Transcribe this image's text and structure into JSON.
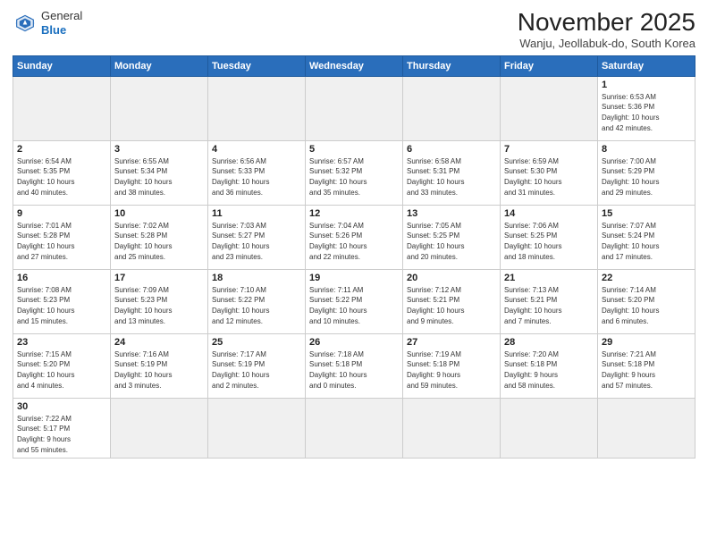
{
  "logo": {
    "general": "General",
    "blue": "Blue"
  },
  "title": "November 2025",
  "subtitle": "Wanju, Jeollabuk-do, South Korea",
  "headers": [
    "Sunday",
    "Monday",
    "Tuesday",
    "Wednesday",
    "Thursday",
    "Friday",
    "Saturday"
  ],
  "weeks": [
    [
      {
        "day": "",
        "info": ""
      },
      {
        "day": "",
        "info": ""
      },
      {
        "day": "",
        "info": ""
      },
      {
        "day": "",
        "info": ""
      },
      {
        "day": "",
        "info": ""
      },
      {
        "day": "",
        "info": ""
      },
      {
        "day": "1",
        "info": "Sunrise: 6:53 AM\nSunset: 5:36 PM\nDaylight: 10 hours\nand 42 minutes."
      }
    ],
    [
      {
        "day": "2",
        "info": "Sunrise: 6:54 AM\nSunset: 5:35 PM\nDaylight: 10 hours\nand 40 minutes."
      },
      {
        "day": "3",
        "info": "Sunrise: 6:55 AM\nSunset: 5:34 PM\nDaylight: 10 hours\nand 38 minutes."
      },
      {
        "day": "4",
        "info": "Sunrise: 6:56 AM\nSunset: 5:33 PM\nDaylight: 10 hours\nand 36 minutes."
      },
      {
        "day": "5",
        "info": "Sunrise: 6:57 AM\nSunset: 5:32 PM\nDaylight: 10 hours\nand 35 minutes."
      },
      {
        "day": "6",
        "info": "Sunrise: 6:58 AM\nSunset: 5:31 PM\nDaylight: 10 hours\nand 33 minutes."
      },
      {
        "day": "7",
        "info": "Sunrise: 6:59 AM\nSunset: 5:30 PM\nDaylight: 10 hours\nand 31 minutes."
      },
      {
        "day": "8",
        "info": "Sunrise: 7:00 AM\nSunset: 5:29 PM\nDaylight: 10 hours\nand 29 minutes."
      }
    ],
    [
      {
        "day": "9",
        "info": "Sunrise: 7:01 AM\nSunset: 5:28 PM\nDaylight: 10 hours\nand 27 minutes."
      },
      {
        "day": "10",
        "info": "Sunrise: 7:02 AM\nSunset: 5:28 PM\nDaylight: 10 hours\nand 25 minutes."
      },
      {
        "day": "11",
        "info": "Sunrise: 7:03 AM\nSunset: 5:27 PM\nDaylight: 10 hours\nand 23 minutes."
      },
      {
        "day": "12",
        "info": "Sunrise: 7:04 AM\nSunset: 5:26 PM\nDaylight: 10 hours\nand 22 minutes."
      },
      {
        "day": "13",
        "info": "Sunrise: 7:05 AM\nSunset: 5:25 PM\nDaylight: 10 hours\nand 20 minutes."
      },
      {
        "day": "14",
        "info": "Sunrise: 7:06 AM\nSunset: 5:25 PM\nDaylight: 10 hours\nand 18 minutes."
      },
      {
        "day": "15",
        "info": "Sunrise: 7:07 AM\nSunset: 5:24 PM\nDaylight: 10 hours\nand 17 minutes."
      }
    ],
    [
      {
        "day": "16",
        "info": "Sunrise: 7:08 AM\nSunset: 5:23 PM\nDaylight: 10 hours\nand 15 minutes."
      },
      {
        "day": "17",
        "info": "Sunrise: 7:09 AM\nSunset: 5:23 PM\nDaylight: 10 hours\nand 13 minutes."
      },
      {
        "day": "18",
        "info": "Sunrise: 7:10 AM\nSunset: 5:22 PM\nDaylight: 10 hours\nand 12 minutes."
      },
      {
        "day": "19",
        "info": "Sunrise: 7:11 AM\nSunset: 5:22 PM\nDaylight: 10 hours\nand 10 minutes."
      },
      {
        "day": "20",
        "info": "Sunrise: 7:12 AM\nSunset: 5:21 PM\nDaylight: 10 hours\nand 9 minutes."
      },
      {
        "day": "21",
        "info": "Sunrise: 7:13 AM\nSunset: 5:21 PM\nDaylight: 10 hours\nand 7 minutes."
      },
      {
        "day": "22",
        "info": "Sunrise: 7:14 AM\nSunset: 5:20 PM\nDaylight: 10 hours\nand 6 minutes."
      }
    ],
    [
      {
        "day": "23",
        "info": "Sunrise: 7:15 AM\nSunset: 5:20 PM\nDaylight: 10 hours\nand 4 minutes."
      },
      {
        "day": "24",
        "info": "Sunrise: 7:16 AM\nSunset: 5:19 PM\nDaylight: 10 hours\nand 3 minutes."
      },
      {
        "day": "25",
        "info": "Sunrise: 7:17 AM\nSunset: 5:19 PM\nDaylight: 10 hours\nand 2 minutes."
      },
      {
        "day": "26",
        "info": "Sunrise: 7:18 AM\nSunset: 5:18 PM\nDaylight: 10 hours\nand 0 minutes."
      },
      {
        "day": "27",
        "info": "Sunrise: 7:19 AM\nSunset: 5:18 PM\nDaylight: 9 hours\nand 59 minutes."
      },
      {
        "day": "28",
        "info": "Sunrise: 7:20 AM\nSunset: 5:18 PM\nDaylight: 9 hours\nand 58 minutes."
      },
      {
        "day": "29",
        "info": "Sunrise: 7:21 AM\nSunset: 5:18 PM\nDaylight: 9 hours\nand 57 minutes."
      }
    ],
    [
      {
        "day": "30",
        "info": "Sunrise: 7:22 AM\nSunset: 5:17 PM\nDaylight: 9 hours\nand 55 minutes."
      },
      {
        "day": "",
        "info": ""
      },
      {
        "day": "",
        "info": ""
      },
      {
        "day": "",
        "info": ""
      },
      {
        "day": "",
        "info": ""
      },
      {
        "day": "",
        "info": ""
      },
      {
        "day": "",
        "info": ""
      }
    ]
  ]
}
